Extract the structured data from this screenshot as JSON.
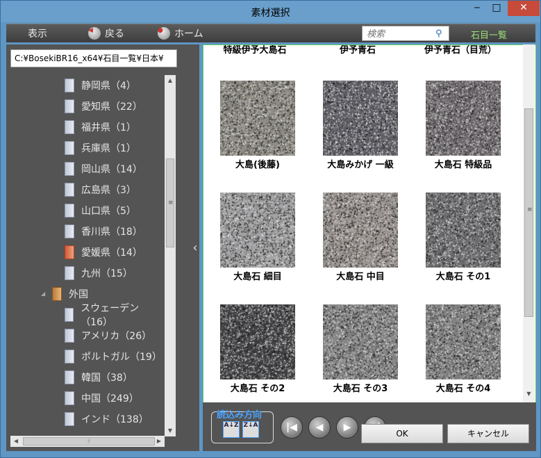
{
  "window": {
    "title": "素材選択",
    "min": "‒",
    "max": "□",
    "close": "✕"
  },
  "toolbar": {
    "view_label": "表示",
    "back_label": "戻る",
    "home_label": "ホーム",
    "search_placeholder": "検索",
    "mode_label": "石目一覧"
  },
  "path": "C:¥BosekiBR16_x64¥石目一覧¥日本¥",
  "tree": [
    {
      "label": "静岡県（4）",
      "selected": false
    },
    {
      "label": "愛知県（22）",
      "selected": false
    },
    {
      "label": "福井県（1）",
      "selected": false
    },
    {
      "label": "兵庫県（1）",
      "selected": false
    },
    {
      "label": "岡山県（14）",
      "selected": false
    },
    {
      "label": "広島県（3）",
      "selected": false
    },
    {
      "label": "山口県（5）",
      "selected": false
    },
    {
      "label": "香川県（18）",
      "selected": false
    },
    {
      "label": "愛媛県（14）",
      "selected": true
    },
    {
      "label": "九州（15）",
      "selected": false
    }
  ],
  "foreign_folder": "外国",
  "foreign_items": [
    {
      "label": "スウェーデン（16）"
    },
    {
      "label": "アメリカ（26）"
    },
    {
      "label": "ポルトガル（19）"
    },
    {
      "label": "韓国（38）"
    },
    {
      "label": "中国（249）"
    },
    {
      "label": "インド（138）"
    }
  ],
  "top_cut_labels": [
    "特級伊予大島石",
    "伊予青石",
    "伊予青石（目荒）"
  ],
  "materials": [
    {
      "label": "大島(後藤)",
      "color": "#8f8c82"
    },
    {
      "label": "大島みかげ 一級",
      "color": "#5e5e66"
    },
    {
      "label": "大島石 特級品",
      "color": "#706a6e"
    },
    {
      "label": "大島石 細目",
      "color": "#a3a3a5"
    },
    {
      "label": "大島石 中目",
      "color": "#9c9490"
    },
    {
      "label": "大島石 その1",
      "color": "#6d6d70"
    },
    {
      "label": "大島石 その2",
      "color": "#3f3f42"
    },
    {
      "label": "大島石 その3",
      "color": "#878787"
    },
    {
      "label": "大島石 その4",
      "color": "#818181"
    }
  ],
  "bottom": {
    "direction_label": "読込み方向",
    "sort_az": "A↓Z",
    "sort_za": "Z↓A",
    "first": "|◀",
    "prev": "◀",
    "next": "▶",
    "last": "▶|",
    "ok_label": "OK",
    "cancel_label": "キャンセル"
  }
}
